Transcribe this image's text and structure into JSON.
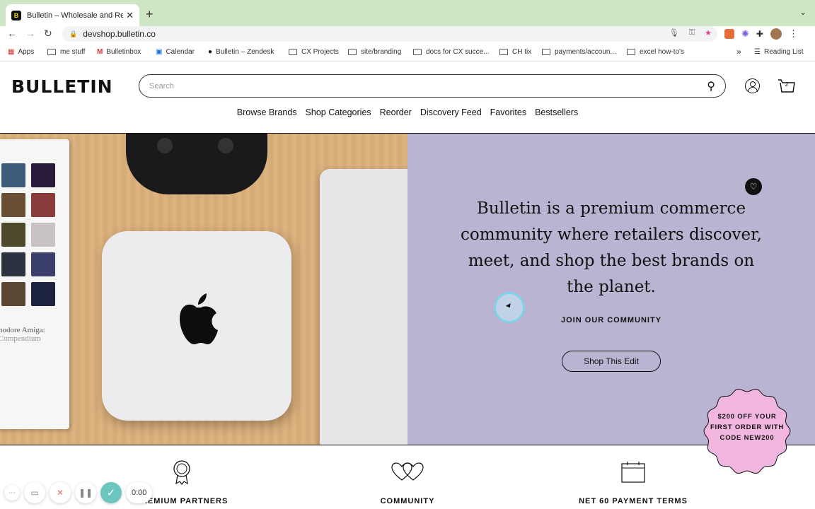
{
  "browser": {
    "tab_title": "Bulletin – Wholesale and Retail",
    "tab_favicon_letter": "B",
    "new_tab": "+",
    "url": "devshop.bulletin.co",
    "bookmarks": [
      {
        "label": "Apps"
      },
      {
        "label": "me stuff"
      },
      {
        "label": "Bulletinbox"
      },
      {
        "label": "Calendar"
      },
      {
        "label": "Bulletin – Zendesk"
      },
      {
        "label": "CX Projects"
      },
      {
        "label": "site/branding"
      },
      {
        "label": "docs for CX succe..."
      },
      {
        "label": "CH tix"
      },
      {
        "label": "payments/accoun..."
      },
      {
        "label": "excel how-to's"
      }
    ],
    "bookmarks_overflow": "»",
    "reading_list": "Reading List"
  },
  "header": {
    "logo": "BULLETIN",
    "search_placeholder": "Search",
    "cart_count": "2"
  },
  "nav": {
    "items": [
      "Browse Brands",
      "Shop Categories",
      "Reorder",
      "Discovery Feed",
      "Favorites",
      "Bestsellers"
    ]
  },
  "hero": {
    "book_caption_1": "nodore Amiga:",
    "book_caption_2": "Compendium",
    "headline": "Bulletin is a premium commerce community where retailers discover, meet, and shop the best brands on the planet.",
    "join_label": "JOIN OUR COMMUNITY",
    "cta": "Shop This Edit"
  },
  "promo": {
    "text": "$200 OFF YOUR FIRST ORDER WITH CODE NEW200"
  },
  "features": [
    {
      "label": "PREMIUM PARTNERS",
      "icon": "award-ribbon-icon"
    },
    {
      "label": "COMMUNITY",
      "icon": "two-hearts-icon"
    },
    {
      "label": "NET 60 PAYMENT TERMS",
      "icon": "calendar-icon"
    }
  ],
  "recorder": {
    "time": "0:00"
  },
  "colors": {
    "hero_panel": "#bbb3d2",
    "promo_badge": "#f1b6e0",
    "tab_strip": "#cfe6c5"
  }
}
